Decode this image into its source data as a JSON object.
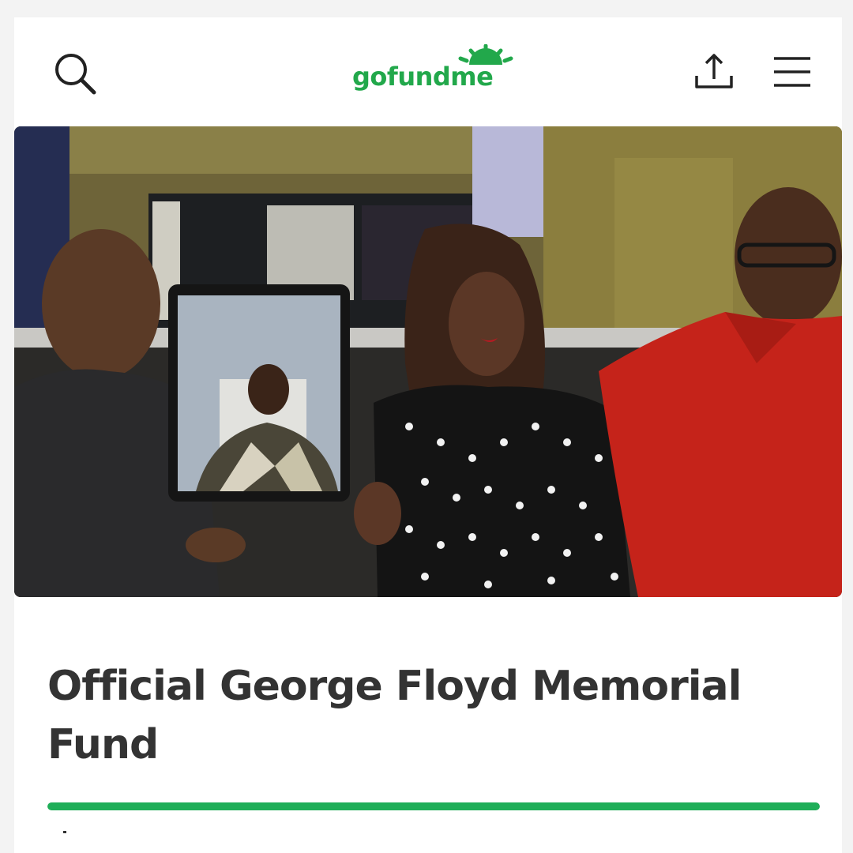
{
  "header": {
    "logo_text": "gofundme",
    "search_icon": "search-icon",
    "share_icon": "share-icon",
    "menu_icon": "hamburger-menu-icon"
  },
  "campaign": {
    "title": "Official George Floyd Memorial Fund",
    "progress_fraction": 1.0
  },
  "colors": {
    "brand_green": "#22a84b",
    "progress_green": "#1fae58",
    "title_text": "#333333"
  }
}
